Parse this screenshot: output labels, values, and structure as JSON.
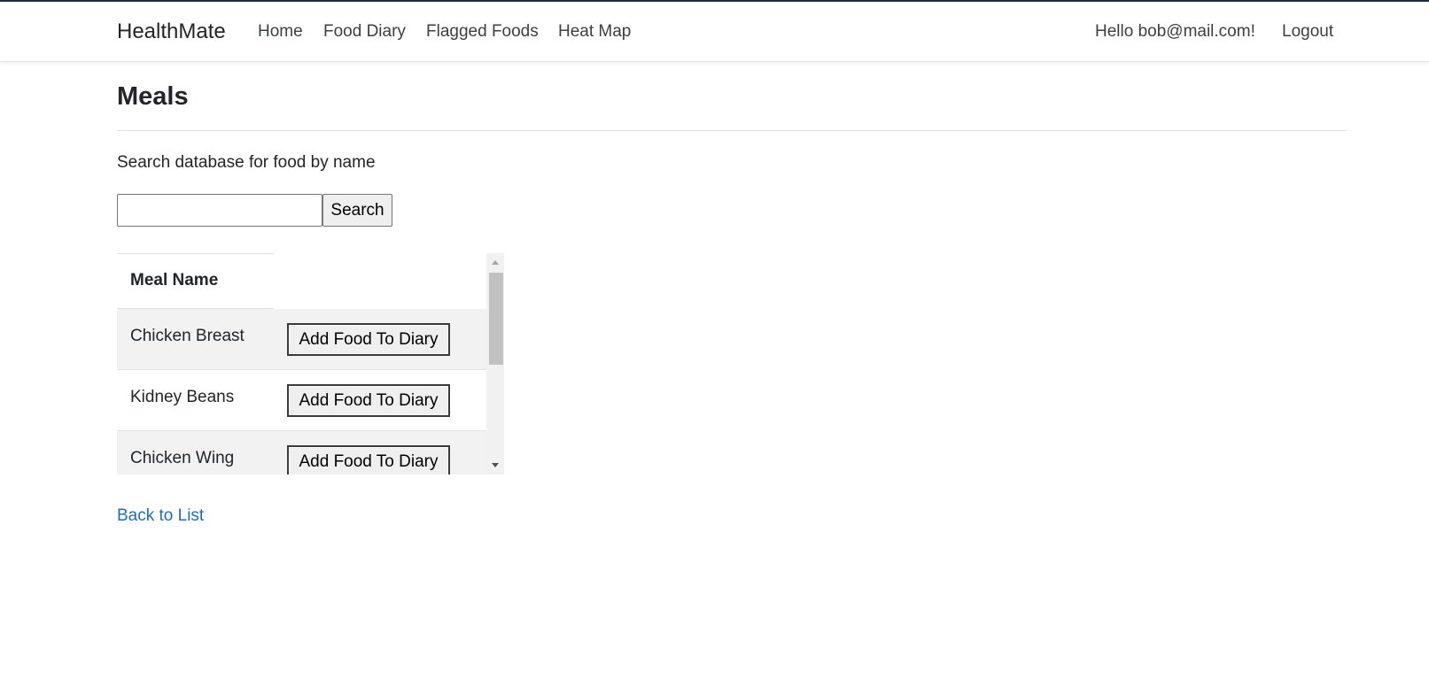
{
  "navbar": {
    "brand": "HealthMate",
    "links": [
      "Home",
      "Food Diary",
      "Flagged Foods",
      "Heat Map"
    ],
    "greeting": "Hello bob@mail.com!",
    "logout": "Logout"
  },
  "main": {
    "title": "Meals",
    "search_label": "Search database for food by name",
    "search_value": "",
    "search_button": "Search",
    "table": {
      "column_header": "Meal Name",
      "add_button_label": "Add Food To Diary",
      "rows": [
        "Chicken Breast",
        "Kidney Beans",
        "Chicken Wing"
      ]
    },
    "back_link": "Back to List"
  },
  "colors": {
    "link": "#1b6ec2",
    "text": "#212529",
    "stripe": "#f2f2f2",
    "border": "#dee2e6"
  }
}
